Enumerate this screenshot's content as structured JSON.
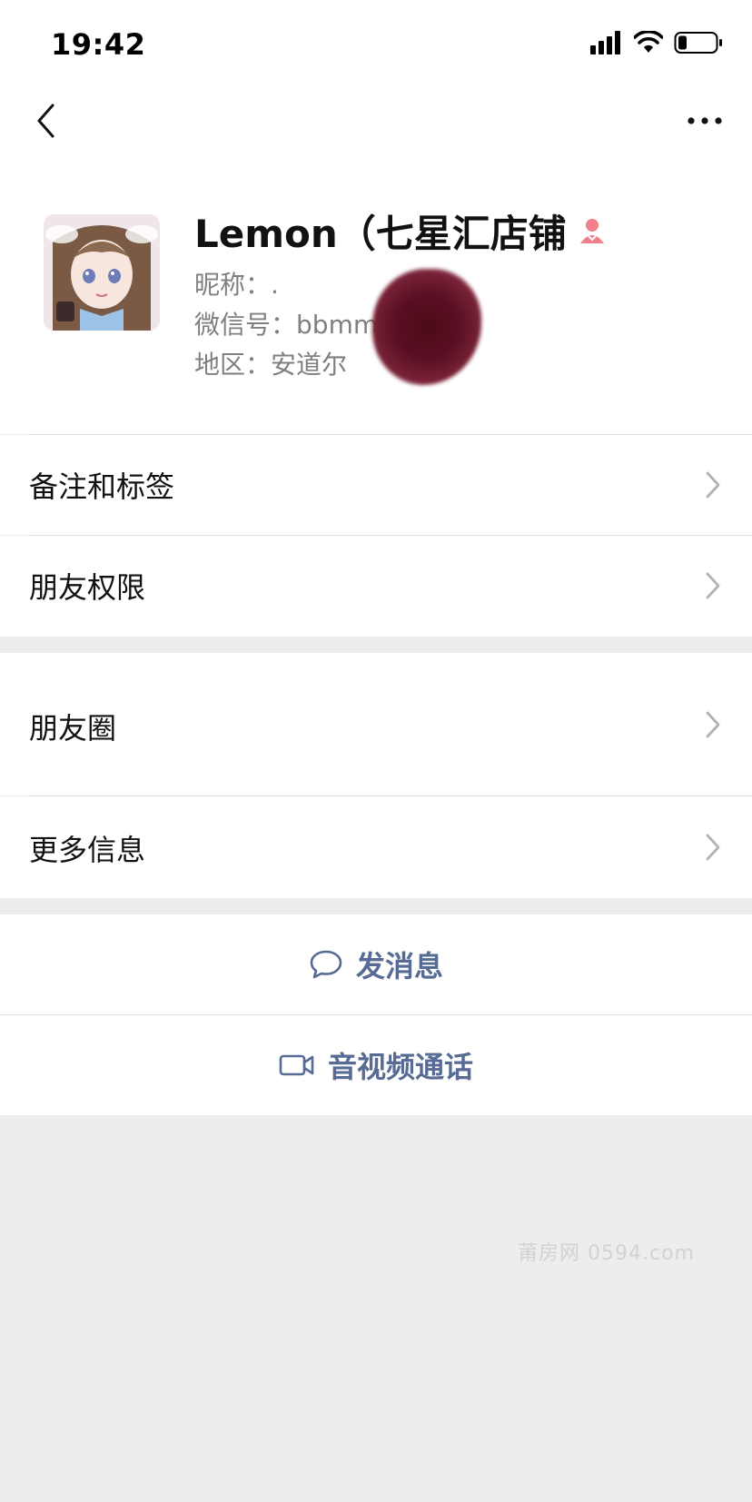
{
  "status_bar": {
    "time": "19:42"
  },
  "profile": {
    "name": "Lemon（七星汇店铺",
    "nickname_label": "昵称：",
    "nickname_value": ".",
    "wechat_id_label": "微信号：",
    "wechat_id_value": "bbmma",
    "region_label": "地区：",
    "region_value": "安道尔"
  },
  "rows": {
    "remarks_tags": "备注和标签",
    "friend_permissions": "朋友权限",
    "moments": "朋友圈",
    "more_info": "更多信息"
  },
  "actions": {
    "send_message": "发消息",
    "video_call": "音视频通话"
  },
  "watermark": "莆房网 0594.com",
  "colors": {
    "link_blue": "#576b95",
    "gender_female": "#f07f8a",
    "background": "#ededed",
    "card": "#ffffff"
  },
  "icons": {
    "back": "chevron-left-icon",
    "more": "more-dots-icon",
    "gender": "female-icon",
    "message": "chat-bubble-icon",
    "video": "video-camera-icon",
    "row_arrow": "chevron-right-icon"
  }
}
